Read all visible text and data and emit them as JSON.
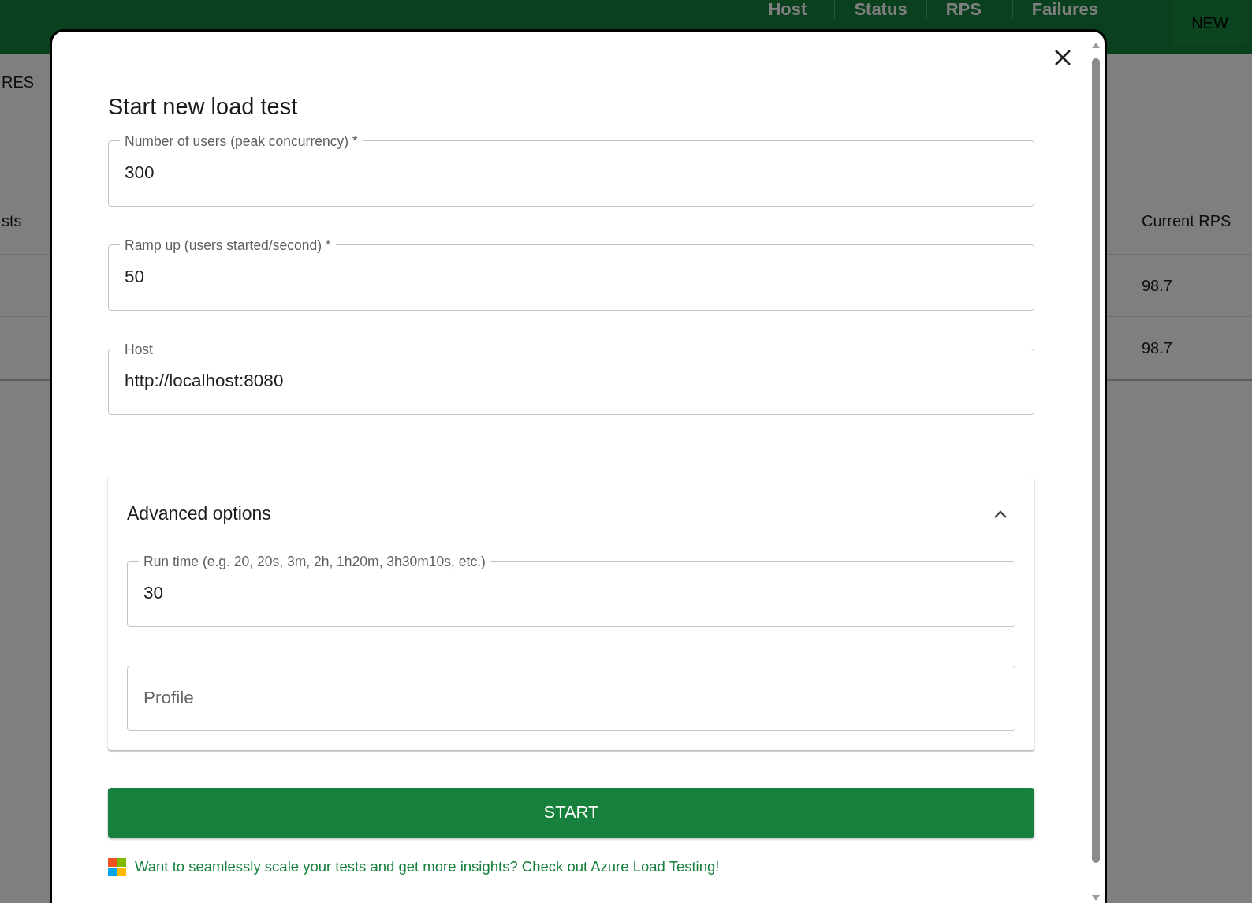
{
  "header": {
    "columns": [
      {
        "label": "Host"
      },
      {
        "label": "Status"
      },
      {
        "label": "RPS"
      },
      {
        "label": "Failures"
      }
    ],
    "new_button": "NEW"
  },
  "background": {
    "tab": "RES",
    "table": {
      "left_heading": "sts",
      "right_heading": "Current RPS",
      "rows": [
        "98.7",
        "98.7"
      ]
    }
  },
  "dialog": {
    "title": "Start new load test",
    "fields": [
      {
        "label": "Number of users (peak concurrency) *",
        "value": "300"
      },
      {
        "label": "Ramp up (users started/second) *",
        "value": "50"
      },
      {
        "label": "Host",
        "value": "http://localhost:8080"
      }
    ],
    "advanced": {
      "title": "Advanced options",
      "expanded": true,
      "fields": [
        {
          "label": "Run time (e.g. 20, 20s, 3m, 2h, 1h20m, 3h30m10s, etc.)",
          "value": "30"
        },
        {
          "placeholder": "Profile"
        }
      ]
    },
    "start_button": "START",
    "promo_link": "Want to seamlessly scale your tests and get more insights? Check out Azure Load Testing!"
  }
}
